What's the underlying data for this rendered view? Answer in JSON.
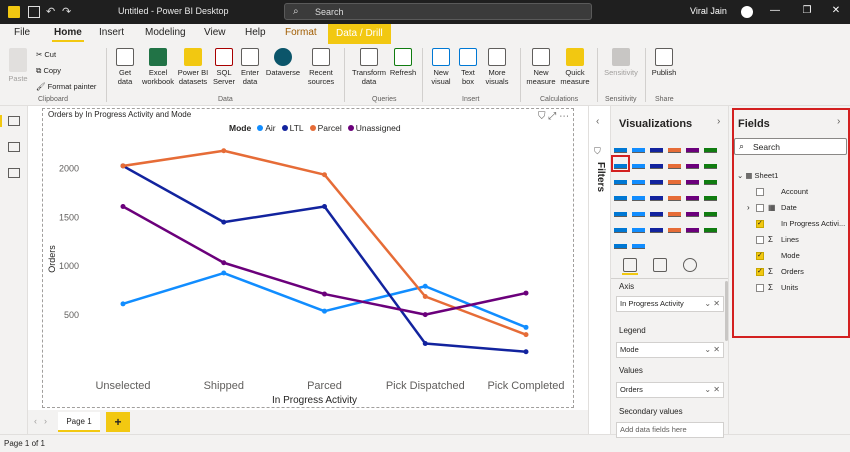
{
  "titlebar": {
    "title": "Untitled - Power BI Desktop",
    "search_placeholder": "Search",
    "user_name": "Viral Jain"
  },
  "ribbon_tabs": [
    "File",
    "Home",
    "Insert",
    "Modeling",
    "View",
    "Help",
    "Format",
    "Data / Drill"
  ],
  "ribbon": {
    "clipboard": {
      "paste": "Paste",
      "cut": "Cut",
      "copy": "Copy",
      "format_painter": "Format painter",
      "label": "Clipboard"
    },
    "data": {
      "get_data": [
        "Get",
        "data"
      ],
      "excel": [
        "Excel",
        "workbook"
      ],
      "pbi_datasets": [
        "Power BI",
        "datasets"
      ],
      "sql": [
        "SQL",
        "Server"
      ],
      "enter_data": [
        "Enter",
        "data"
      ],
      "dataverse": [
        "Dataverse"
      ],
      "recent_sources": [
        "Recent",
        "sources"
      ],
      "label": "Data"
    },
    "queries": {
      "transform": [
        "Transform",
        "data"
      ],
      "refresh": [
        "Refresh"
      ],
      "label": "Queries"
    },
    "insert": {
      "new_visual": [
        "New",
        "visual"
      ],
      "text_box": [
        "Text",
        "box"
      ],
      "more_visuals": [
        "More",
        "visuals"
      ],
      "label": "Insert"
    },
    "calculations": {
      "new_measure": [
        "New",
        "measure"
      ],
      "quick_measure": [
        "Quick",
        "measure"
      ],
      "label": "Calculations"
    },
    "sensitivity": {
      "btn": [
        "Sensitivity"
      ],
      "label": "Sensitivity"
    },
    "share": {
      "publish": [
        "Publish"
      ],
      "label": "Share"
    }
  },
  "chart_data": {
    "type": "line",
    "title": "Orders by In Progress Activity and Mode",
    "xlabel": "In Progress Activity",
    "ylabel": "Orders",
    "categories": [
      "Unselected",
      "Shipped",
      "Parced",
      "Pick Dispatched",
      "Pick Completed"
    ],
    "ylim": [
      0,
      2300
    ],
    "yticks": [
      500,
      1000,
      1500,
      2000
    ],
    "legend_title": "Mode",
    "legend_position": "top",
    "grid": false,
    "series": [
      {
        "name": "Air",
        "color": "#118dff",
        "values": [
          615,
          930,
          540,
          795,
          375
        ]
      },
      {
        "name": "LTL",
        "color": "#12239e",
        "values": [
          2025,
          1450,
          1610,
          210,
          125
        ]
      },
      {
        "name": "Parcel",
        "color": "#e66c37",
        "values": [
          2025,
          2180,
          1935,
          690,
          300
        ]
      },
      {
        "name": "Unassigned",
        "color": "#6b007b",
        "values": [
          1610,
          1035,
          715,
          505,
          725
        ]
      }
    ]
  },
  "pages": {
    "tab": "Page 1",
    "add": "+"
  },
  "status": "Page 1 of 1",
  "filters": {
    "label": "Filters"
  },
  "viz_pane": {
    "title": "Visualizations",
    "wells": [
      {
        "label": "Axis",
        "value": "In Progress Activity"
      },
      {
        "label": "Legend",
        "value": "Mode"
      },
      {
        "label": "Values",
        "value": "Orders"
      },
      {
        "label": "Secondary values",
        "value": "Add data fields here"
      }
    ]
  },
  "fields_pane": {
    "title": "Fields",
    "search_placeholder": "Search",
    "table": "Sheet1",
    "fields": [
      {
        "name": "Account",
        "checked": false,
        "sigma": false
      },
      {
        "name": "Date",
        "checked": false,
        "sigma": false
      },
      {
        "name": "In Progress Activi...",
        "checked": true,
        "sigma": false
      },
      {
        "name": "Lines",
        "checked": false,
        "sigma": true
      },
      {
        "name": "Mode",
        "checked": true,
        "sigma": false
      },
      {
        "name": "Orders",
        "checked": true,
        "sigma": true
      },
      {
        "name": "Units",
        "checked": false,
        "sigma": true
      }
    ]
  }
}
